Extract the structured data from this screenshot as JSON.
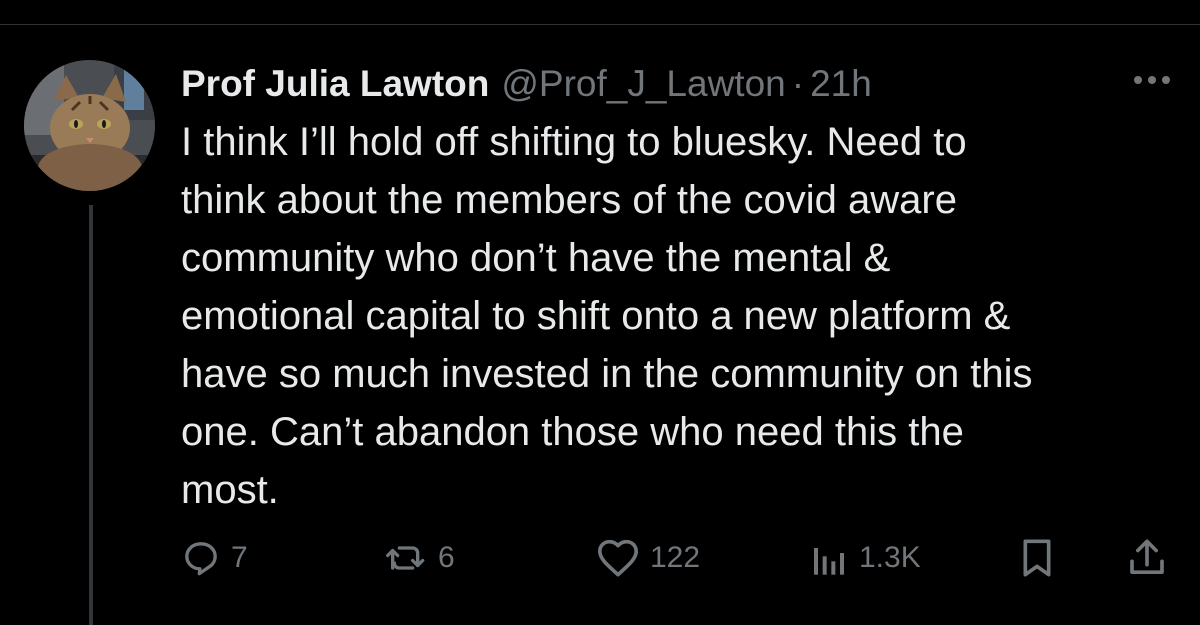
{
  "tweet": {
    "author_name": "Prof Julia Lawton",
    "handle": "@Prof_J_Lawton",
    "separator": "·",
    "time": "21h",
    "text": "I think I’ll hold off shifting to bluesky. Need to\nthink about the members of the covid aware\ncommunity who don’t have the mental &\nemotional capital to shift onto a new platform &\nhave so much invested in the community on this\none. Can’t abandon those who need this the\nmost."
  },
  "actions": {
    "replies": "7",
    "retweets": "6",
    "likes": "122",
    "views": "1.3K"
  },
  "icons": {
    "reply": "reply-icon",
    "retweet": "retweet-icon",
    "like": "heart-icon",
    "views": "views-icon",
    "bookmark": "bookmark-icon",
    "share": "share-icon",
    "more": "more-icon"
  },
  "colors": {
    "background": "#000000",
    "primary_text": "#e7e9ea",
    "secondary_text": "#71767b",
    "divider": "#2f3336"
  }
}
